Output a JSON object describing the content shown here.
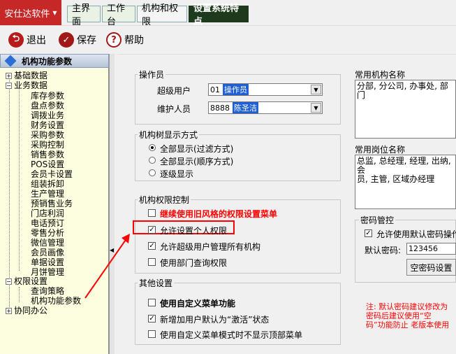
{
  "app": {
    "brand": "安仕达软件"
  },
  "tabs": [
    {
      "label": "主界面"
    },
    {
      "label": "工作台"
    },
    {
      "label": "机构和权限"
    },
    {
      "label": "设置系统特点"
    }
  ],
  "toolbar": {
    "exit_label": "退出",
    "save_label": "保存",
    "help_label": "帮助"
  },
  "tree": {
    "title": "机构功能参数",
    "groups": [
      {
        "label": "基础数据"
      },
      {
        "label": "业务数据"
      },
      {
        "label": "权限设置"
      },
      {
        "label": "协同办公"
      }
    ],
    "business_items": [
      "库存参数",
      "盘点参数",
      "调拨业务",
      "财务设置",
      "采购参数",
      "采购控制",
      "销售参数",
      "POS设置",
      "会员卡设置",
      "组装拆卸",
      "生产管理",
      "预销售业务",
      "门店利润",
      "电话预订",
      "零售分析",
      "微信管理",
      "会员画像",
      "单据设置",
      "月饼管理"
    ],
    "permission_items": [
      "查询策略",
      "机构功能参数"
    ]
  },
  "operator": {
    "title": "操作员",
    "super_user_label": "超级用户",
    "super_user_code": "01",
    "super_user_name": "操作员",
    "maintainer_label": "维护人员",
    "maintainer_code": "8888",
    "maintainer_name": "陈圣洁"
  },
  "org_tree": {
    "title": "机构树显示方式",
    "options": [
      "全部显示(过滤方式)",
      "全部显示(顺序方式)",
      "逐级显示"
    ],
    "selected": 0
  },
  "perm_control": {
    "title": "机构权限控制",
    "options": [
      {
        "label": "继续使用旧风格的权限设置菜单",
        "checked": false
      },
      {
        "label": "允许设置个人权限",
        "checked": true
      },
      {
        "label": "允许超级用户管理所有机构",
        "checked": true
      },
      {
        "label": "使用部门查询权限",
        "checked": false
      }
    ]
  },
  "other": {
    "title": "其他设置",
    "options": [
      {
        "label": "使用自定义菜单功能",
        "checked": false
      },
      {
        "label": "新增加用户默认为“激活”状态",
        "checked": true
      },
      {
        "label": "使用自定义菜单模式时不显示顶部菜单",
        "checked": false
      }
    ]
  },
  "common_org": {
    "title": "常用机构名称",
    "value": "分部, 分公司, 办事处, 部门"
  },
  "common_post": {
    "title": "常用岗位名称",
    "value_line1": "总监, 总经理, 经理, 出纳, 会",
    "value_line2": "员, 主管, 区域办经理"
  },
  "password": {
    "title": "密码管控",
    "allow_default_label": "允许使用默认密码操作",
    "default_label": "默认密码:",
    "default_value": "123456",
    "empty_button": "空密码设置",
    "note_line1": "注: 默认密码建议修改为",
    "note_line2": "密码后建议使用“空",
    "note_line3": "码”功能防止 老版本使用"
  },
  "colors": {
    "brand": "#c62828",
    "highlight": "#ff0000",
    "selection": "#1e5fd8"
  }
}
